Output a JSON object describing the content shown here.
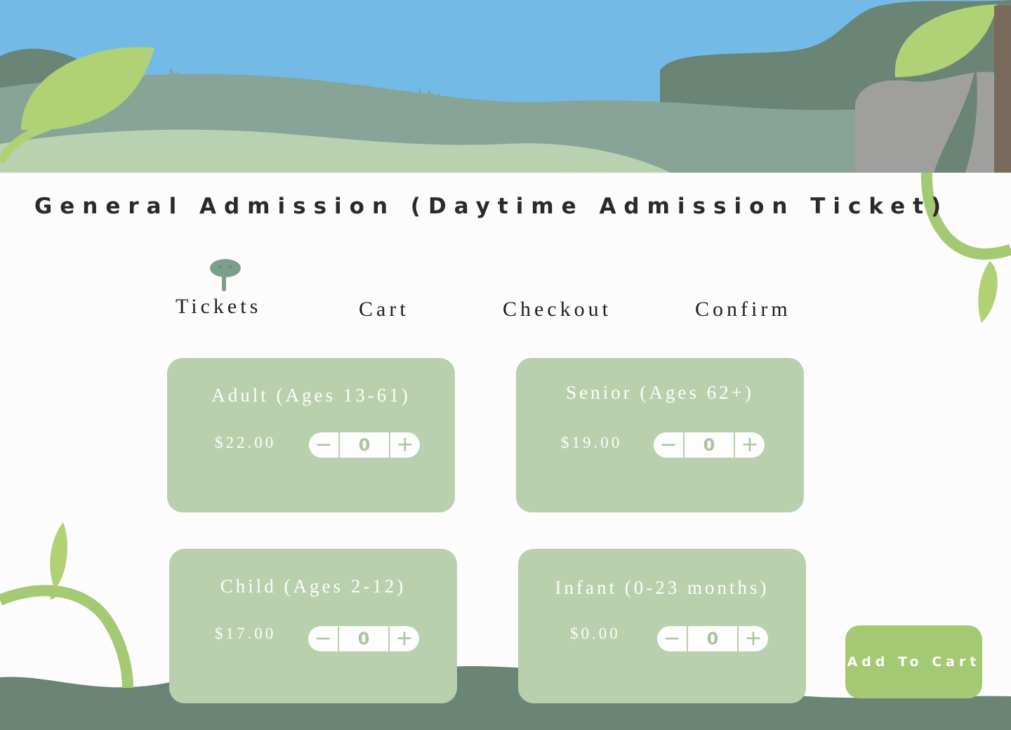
{
  "page": {
    "title": "General Admission (Daytime Admission Ticket)"
  },
  "steps": [
    {
      "label": "Tickets",
      "active": true
    },
    {
      "label": "Cart"
    },
    {
      "label": "Checkout"
    },
    {
      "label": "Confirm"
    }
  ],
  "tickets": [
    {
      "title": "Adult (Ages 13-61)",
      "price": "$22.00",
      "quantity": "0"
    },
    {
      "title": "Senior (Ages 62+)",
      "price": "$19.00",
      "quantity": "0"
    },
    {
      "title": "Child (Ages 2-12)",
      "price": "$17.00",
      "quantity": "0"
    },
    {
      "title": "Infant (0-23 months)",
      "price": "$0.00",
      "quantity": "0"
    }
  ],
  "stepper": {
    "minus": "−",
    "plus": "+"
  },
  "actions": {
    "add_to_cart": "Add To Cart"
  },
  "colors": {
    "sky": "#73bbe6",
    "hill_dark": "#6a8476",
    "hill_mid": "#87a497",
    "hill_light": "#b8d1ae",
    "leaf": "#b0d274",
    "vine": "#a3c972",
    "card": "#b8d0ac",
    "rock": "#9fa09e",
    "trunk": "#7a6a5c"
  },
  "icons": {
    "step_marker": "elephant-icon"
  }
}
